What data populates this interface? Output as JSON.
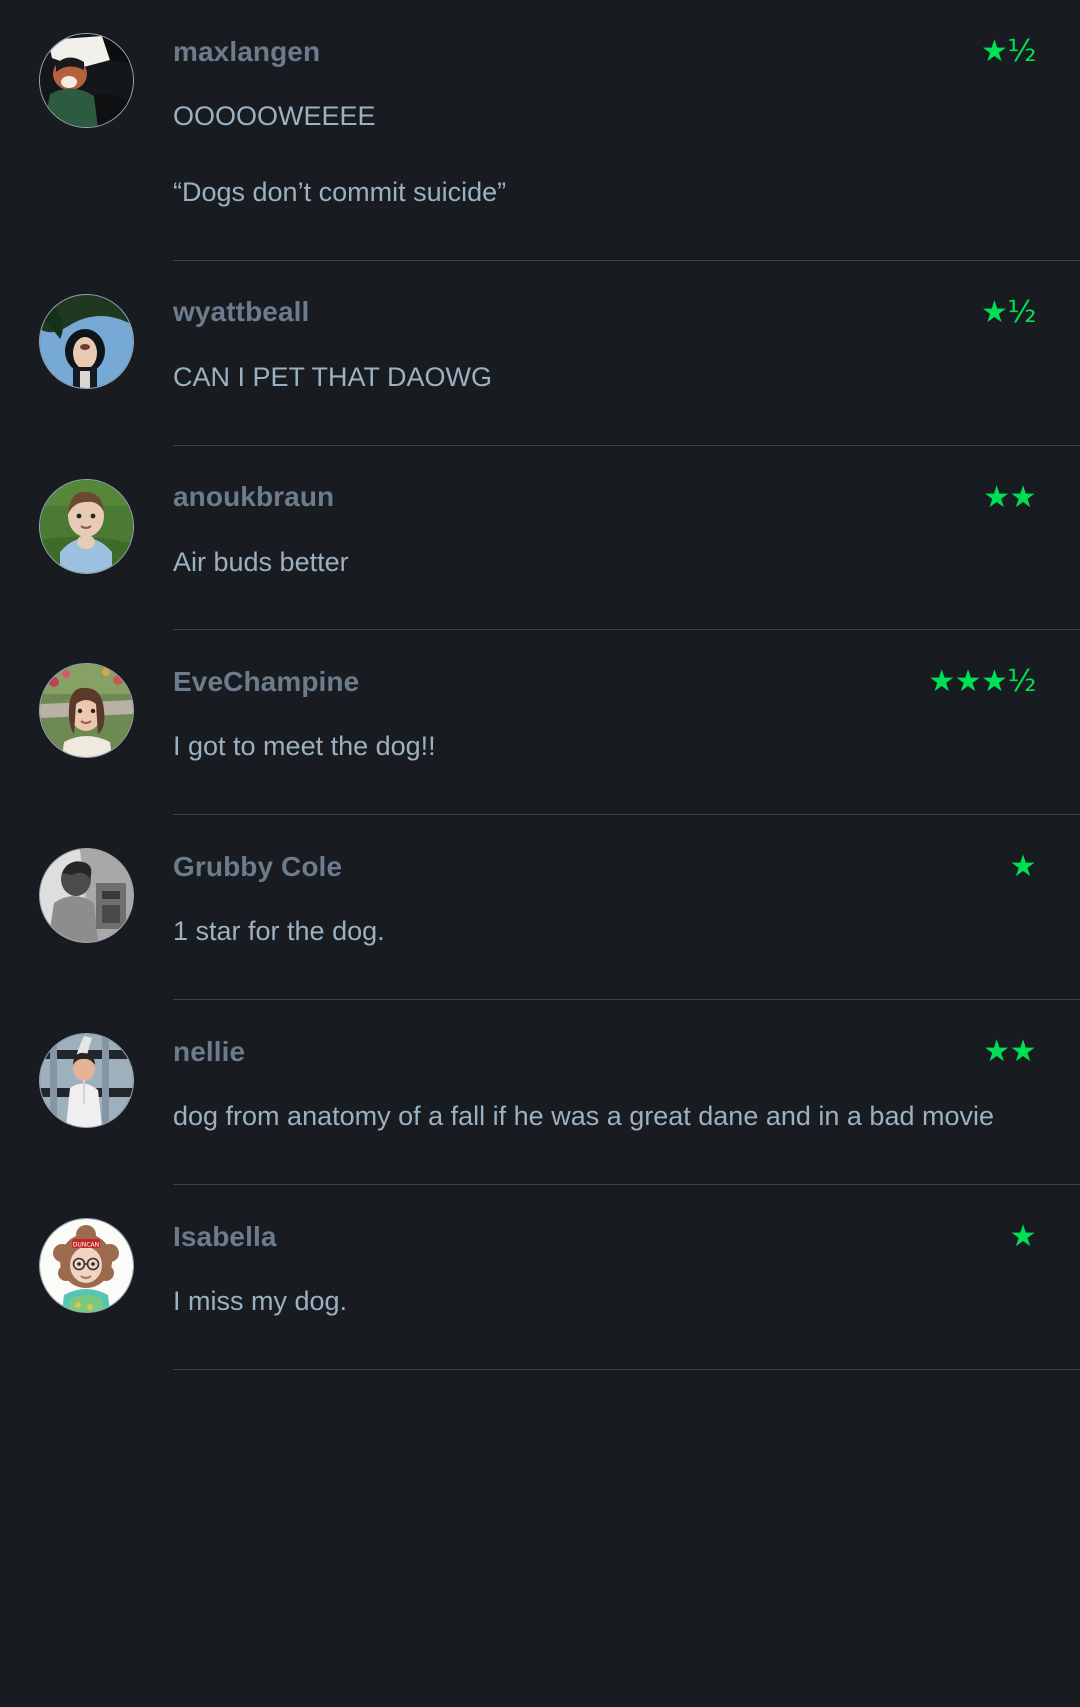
{
  "theme": {
    "background": "#181c21",
    "username_color": "#6c7c8c",
    "text_color": "#9bb0c0",
    "star_color": "#00e054",
    "divider_color": "#3a4450"
  },
  "screen": {
    "name": "letterboxd-film-reviews-list"
  },
  "reviews": [
    {
      "username": "maxlangen",
      "rating": "★½",
      "rating_value": 1.5,
      "avatar_name": "avatar-maxlangen",
      "lines": [
        "OOOOOWEEEE",
        "“Dogs don’t commit suicide”"
      ]
    },
    {
      "username": "wyattbeall",
      "rating": "★½",
      "rating_value": 1.5,
      "avatar_name": "avatar-wyattbeall",
      "lines": [
        "CAN I PET THAT DAOWG"
      ]
    },
    {
      "username": "anoukbraun",
      "rating": "★★",
      "rating_value": 2,
      "avatar_name": "avatar-anoukbraun",
      "lines": [
        "Air buds better"
      ]
    },
    {
      "username": "EveChampine",
      "rating": "★★★½",
      "rating_value": 3.5,
      "avatar_name": "avatar-evechampine",
      "lines": [
        "I got to meet the dog!!"
      ]
    },
    {
      "username": "Grubby Cole",
      "rating": "★",
      "rating_value": 1,
      "avatar_name": "avatar-grubby-cole",
      "lines": [
        "1 star for the dog."
      ]
    },
    {
      "username": "nellie",
      "rating": "★★",
      "rating_value": 2,
      "avatar_name": "avatar-nellie",
      "lines": [
        "dog from anatomy of a fall if he was a great dane and in a bad movie"
      ]
    },
    {
      "username": "Isabella",
      "rating": "★",
      "rating_value": 1,
      "avatar_name": "avatar-isabella",
      "lines": [
        "I miss my dog."
      ]
    }
  ]
}
